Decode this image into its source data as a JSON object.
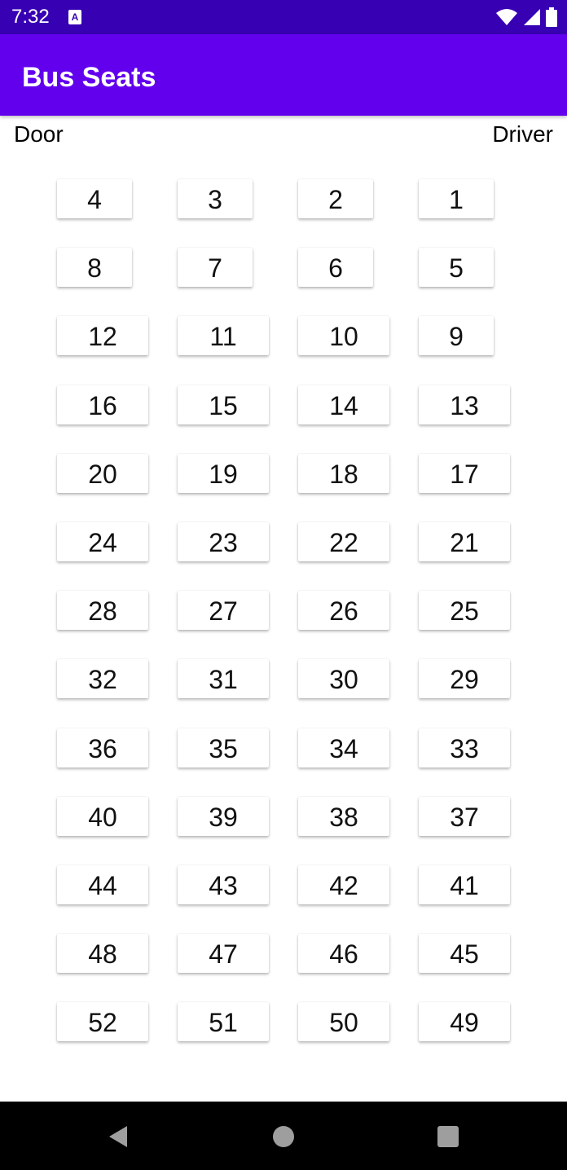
{
  "status_bar": {
    "time": "7:32",
    "notification_icon": "A",
    "icons": [
      "wifi-icon",
      "signal-icon",
      "battery-icon"
    ],
    "background": "#3700b3"
  },
  "app_bar": {
    "title": "Bus Seats",
    "background": "#6200ee"
  },
  "labels": {
    "door": "Door",
    "driver": "Driver"
  },
  "seat_rows": [
    [
      "4",
      "3",
      "2",
      "1"
    ],
    [
      "8",
      "7",
      "6",
      "5"
    ],
    [
      "12",
      "11",
      "10",
      "9"
    ],
    [
      "16",
      "15",
      "14",
      "13"
    ],
    [
      "20",
      "19",
      "18",
      "17"
    ],
    [
      "24",
      "23",
      "22",
      "21"
    ],
    [
      "28",
      "27",
      "26",
      "25"
    ],
    [
      "32",
      "31",
      "30",
      "29"
    ],
    [
      "36",
      "35",
      "34",
      "33"
    ],
    [
      "40",
      "39",
      "38",
      "37"
    ],
    [
      "44",
      "43",
      "42",
      "41"
    ],
    [
      "48",
      "47",
      "46",
      "45"
    ],
    [
      "52",
      "51",
      "50",
      "49"
    ]
  ],
  "nav_bar": {
    "buttons": [
      "back-icon",
      "home-icon",
      "recents-icon"
    ]
  }
}
